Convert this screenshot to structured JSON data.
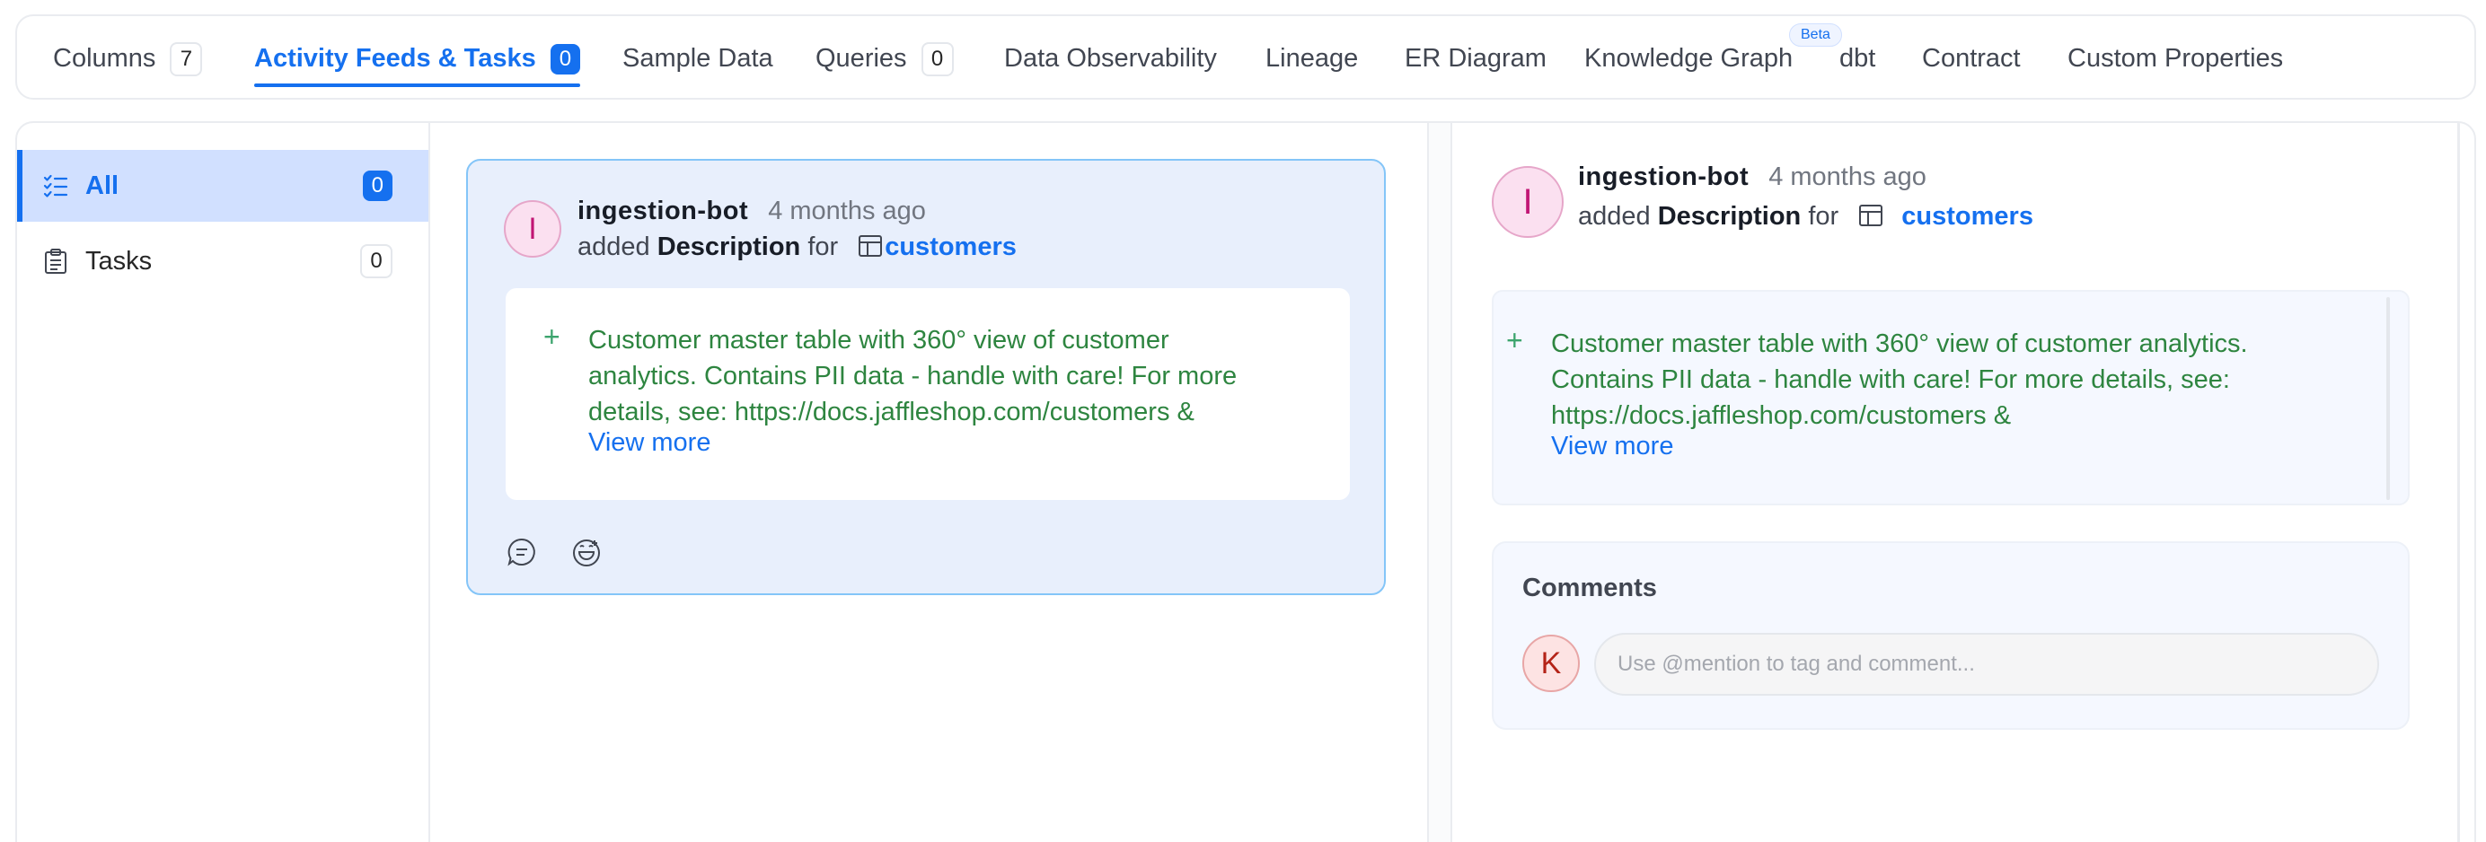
{
  "tabs": [
    {
      "label": "Columns",
      "count": "7"
    },
    {
      "label": "Activity Feeds & Tasks",
      "count": "0"
    },
    {
      "label": "Sample Data"
    },
    {
      "label": "Queries",
      "count": "0"
    },
    {
      "label": "Data Observability"
    },
    {
      "label": "Lineage"
    },
    {
      "label": "ER Diagram"
    },
    {
      "label": "Knowledge Graph",
      "badge": "Beta"
    },
    {
      "label": "dbt"
    },
    {
      "label": "Contract"
    },
    {
      "label": "Custom Properties"
    }
  ],
  "active_tab": "Activity Feeds & Tasks",
  "sidebar": {
    "items": [
      {
        "label": "All",
        "count": "0",
        "icon": "checklist-icon"
      },
      {
        "label": "Tasks",
        "count": "0",
        "icon": "clipboard-icon"
      }
    ]
  },
  "feed": {
    "avatar_letter": "I",
    "author": "ingestion-bot",
    "time": "4 months ago",
    "action_prefix": "added",
    "field": "Description",
    "preposition": "for",
    "entity": "customers",
    "diff_sign": "+",
    "description_line1": "Customer master table with 360° view of customer",
    "description_line2": "analytics. Contains PII data - handle with care! For more",
    "description_line3": "details, see: https://docs.jaffleshop.com/customers &",
    "view_more": "View more"
  },
  "detail": {
    "avatar_letter": "I",
    "author": "ingestion-bot",
    "time": "4 months ago",
    "action_prefix": "added",
    "field": "Description",
    "preposition": "for",
    "entity": "customers",
    "diff_sign": "+",
    "description_line1": "Customer master table with 360° view of customer analytics.",
    "description_line2": "Contains PII data - handle with care! For more details, see:",
    "description_line3": "https://docs.jaffleshop.com/customers &",
    "view_more": "View more"
  },
  "comments": {
    "title": "Comments",
    "user_initial": "K",
    "placeholder": "Use @mention to tag and comment..."
  },
  "colors": {
    "accent": "#1570ef",
    "added_text": "#2e8540",
    "card_bg": "#e8effc"
  }
}
